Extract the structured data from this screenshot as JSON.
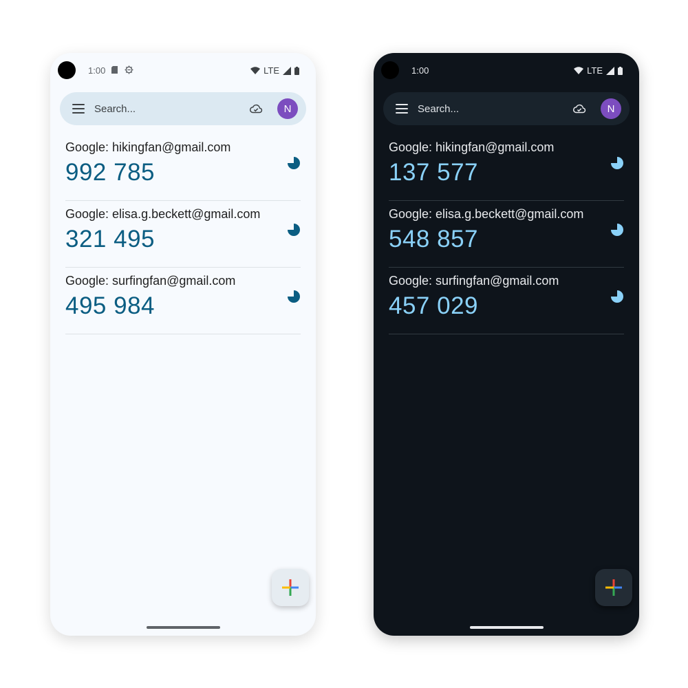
{
  "colors": {
    "light_background": "#f7fafe",
    "dark_background": "#0e141b",
    "light_code": "#0b5d82",
    "dark_code": "#8ad1f8",
    "avatar": "#7c4dbf"
  },
  "light": {
    "status": {
      "time": "1:00",
      "network": "LTE",
      "icons": [
        "sim-card-icon",
        "bug-icon",
        "wifi-icon",
        "signal-icon",
        "battery-icon"
      ]
    },
    "search": {
      "placeholder": "Search...",
      "avatar_initial": "N"
    },
    "accounts": [
      {
        "account": "Google: hikingfan@gmail.com",
        "code": "992 785",
        "timer_remaining": 0.75
      },
      {
        "account": "Google: elisa.g.beckett@gmail.com",
        "code": "321 495",
        "timer_remaining": 0.75
      },
      {
        "account": "Google: surfingfan@gmail.com",
        "code": "495 984",
        "timer_remaining": 0.75
      }
    ]
  },
  "dark": {
    "status": {
      "time": "1:00",
      "network": "LTE",
      "icons": [
        "wifi-icon",
        "signal-icon",
        "battery-icon"
      ]
    },
    "search": {
      "placeholder": "Search...",
      "avatar_initial": "N"
    },
    "accounts": [
      {
        "account": "Google: hikingfan@gmail.com",
        "code": "137 577",
        "timer_remaining": 0.75
      },
      {
        "account": "Google: elisa.g.beckett@gmail.com",
        "code": "548 857",
        "timer_remaining": 0.75
      },
      {
        "account": "Google: surfingfan@gmail.com",
        "code": "457 029",
        "timer_remaining": 0.75
      }
    ]
  }
}
